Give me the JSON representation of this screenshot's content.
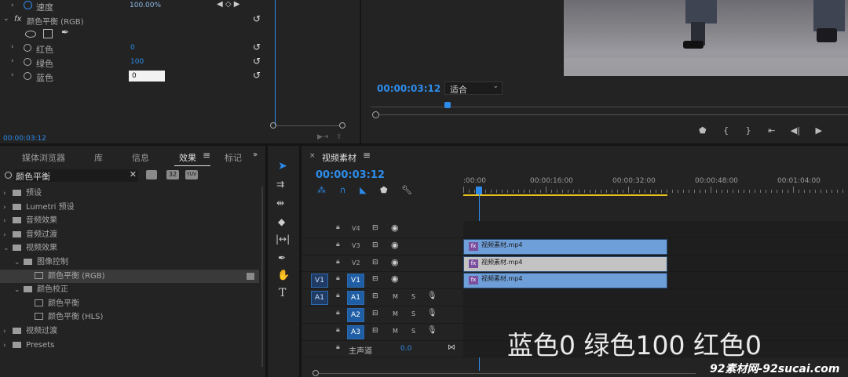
{
  "effect_controls": {
    "speed_label": "速度",
    "speed_value": "100.00%",
    "fx_label": "fx",
    "effect_name": "颜色平衡 (RGB)",
    "params": [
      {
        "label": "红色",
        "value": "0"
      },
      {
        "label": "绿色",
        "value": "100"
      },
      {
        "label": "蓝色",
        "value": "0"
      }
    ],
    "timecode": "00:00:03:12"
  },
  "program_monitor": {
    "timecode": "00:00:03:12",
    "fit_label": "适合"
  },
  "effects_panel": {
    "tabs": [
      "媒体浏览器",
      "库",
      "信息",
      "效果",
      "标记"
    ],
    "active_tab": "效果",
    "search_value": "颜色平衡",
    "filter_labels": [
      "32",
      "YUV"
    ],
    "tree": [
      {
        "label": "预设",
        "type": "folder",
        "level": 0
      },
      {
        "label": "Lumetri 预设",
        "type": "folder",
        "level": 0
      },
      {
        "label": "音频效果",
        "type": "folder",
        "level": 0
      },
      {
        "label": "音频过渡",
        "type": "folder",
        "level": 0
      },
      {
        "label": "视频效果",
        "type": "folder",
        "level": 0
      },
      {
        "label": "图像控制",
        "type": "folder",
        "level": 1
      },
      {
        "label": "颜色平衡 (RGB)",
        "type": "preset",
        "level": 2
      },
      {
        "label": "颜色校正",
        "type": "folder",
        "level": 1
      },
      {
        "label": "颜色平衡",
        "type": "preset",
        "level": 2
      },
      {
        "label": "颜色平衡 (HLS)",
        "type": "preset",
        "level": 2
      },
      {
        "label": "视频过渡",
        "type": "folder",
        "level": 0
      },
      {
        "label": "Presets",
        "type": "folder",
        "level": 0
      }
    ]
  },
  "timeline": {
    "sequence_name": "视频素材",
    "timecode": "00:00:03:12",
    "ruler": [
      ":00:00",
      "00:00:16:00",
      "00:00:32:00",
      "00:00:48:00",
      "00:01:04:00"
    ],
    "video_tracks": [
      "V4",
      "V3",
      "V2",
      "V1"
    ],
    "audio_tracks": [
      "A1",
      "A2",
      "A3"
    ],
    "source_v": "V1",
    "source_a": "A1",
    "mute_label": "M",
    "solo_label": "S",
    "master_label": "主声道",
    "master_value": "0.0",
    "clips": [
      {
        "track": "V3",
        "name": "视频素材.mp4"
      },
      {
        "track": "V2",
        "name": "视频素材.mp4"
      },
      {
        "track": "V1",
        "name": "视频素材.mp4"
      }
    ]
  },
  "overlay": {
    "caption": "蓝色0 绿色100 红色0",
    "watermark": "92素材网-92sucai.com"
  },
  "colors": {
    "accent": "#2d8ceb",
    "clip_blue": "#6f9fd8",
    "clip_gray": "#c3c3c3",
    "work_area": "#e6c020"
  }
}
